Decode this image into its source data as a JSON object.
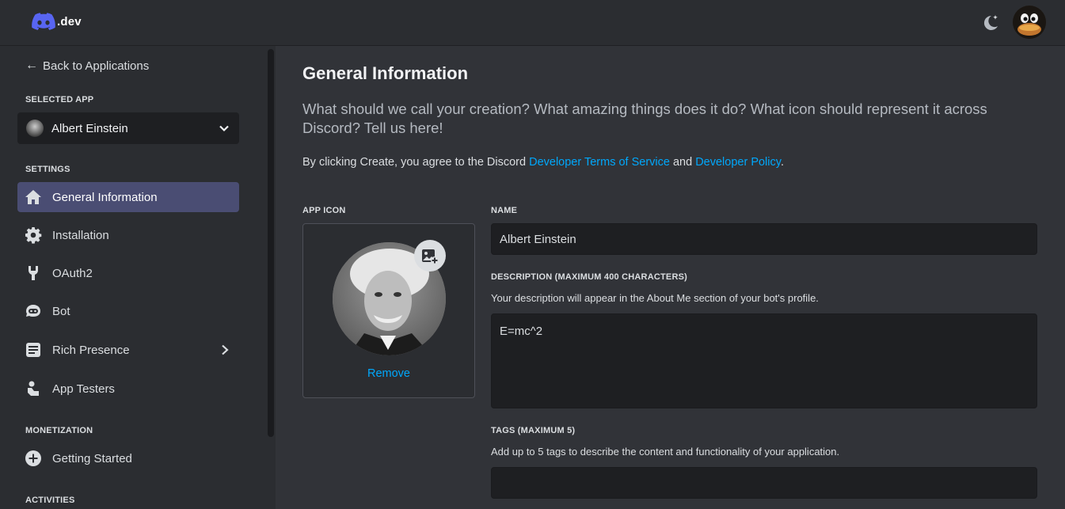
{
  "header": {
    "logo_text": ".dev",
    "theme_toggle_icon": "moon-icon",
    "avatar_icon": "user-avatar"
  },
  "sidebar": {
    "back_label": "Back to Applications",
    "selected_app_label": "SELECTED APP",
    "selected_app_name": "Albert Einstein",
    "settings_label": "SETTINGS",
    "items": [
      {
        "label": "General Information",
        "icon": "home-icon",
        "active": true
      },
      {
        "label": "Installation",
        "icon": "gear-icon"
      },
      {
        "label": "OAuth2",
        "icon": "wrench-icon"
      },
      {
        "label": "Bot",
        "icon": "bot-icon"
      },
      {
        "label": "Rich Presence",
        "icon": "document-icon",
        "has_submenu": true
      },
      {
        "label": "App Testers",
        "icon": "user-icon"
      }
    ],
    "monetization_label": "MONETIZATION",
    "monetization_items": [
      {
        "label": "Getting Started",
        "icon": "plus-circle-icon"
      }
    ],
    "activities_label": "ACTIVITIES"
  },
  "main": {
    "title": "General Information",
    "subtitle": "What should we call your creation? What amazing things does it do? What icon should represent it across Discord? Tell us here!",
    "agree_prefix": "By clicking Create, you agree to the Discord ",
    "terms_link": "Developer Terms of Service",
    "agree_and": " and ",
    "policy_link": "Developer Policy",
    "agree_suffix": ".",
    "app_icon_label": "APP ICON",
    "remove_label": "Remove",
    "name_label": "NAME",
    "name_value": "Albert Einstein",
    "description_label": "DESCRIPTION (MAXIMUM 400 CHARACTERS)",
    "description_help": "Your description will appear in the About Me section of your bot's profile.",
    "description_value": "E=mc^2",
    "tags_label": "TAGS (MAXIMUM 5)",
    "tags_help": "Add up to 5 tags to describe the content and functionality of your application.",
    "tags_value": ""
  },
  "colors": {
    "background": "#313338",
    "sidebar": "#2b2d31",
    "active_item": "#4a4d73",
    "link": "#00a8fc",
    "brand": "#5865f2"
  }
}
